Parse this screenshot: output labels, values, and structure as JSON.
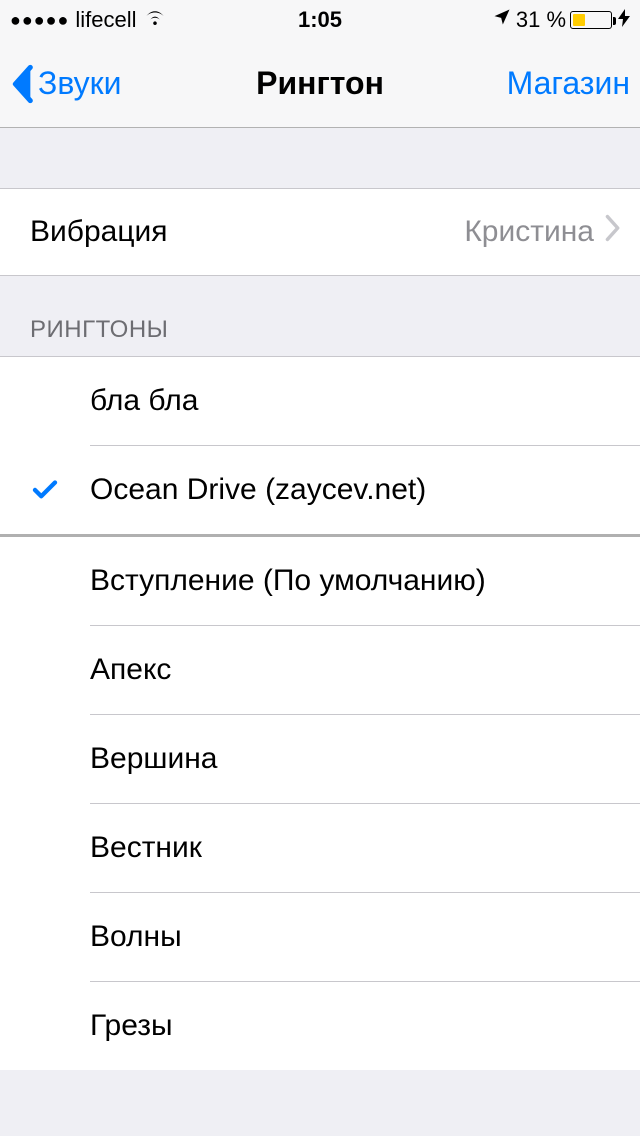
{
  "status": {
    "carrier": "lifecell",
    "time": "1:05",
    "battery_text": "31 %",
    "battery_fill_pct": 31
  },
  "nav": {
    "back_label": "Звуки",
    "title": "Рингтон",
    "right_label": "Магазин"
  },
  "vibration_row": {
    "label": "Вибрация",
    "value": "Кристина"
  },
  "ringtones_header": "РИНГТОНЫ",
  "ringtones_custom": [
    {
      "label": "бла бла",
      "selected": false
    },
    {
      "label": "Ocean Drive (zaycev.net)",
      "selected": true
    }
  ],
  "ringtones_system": [
    {
      "label": "Вступление (По умолчанию)"
    },
    {
      "label": "Апекс"
    },
    {
      "label": "Вершина"
    },
    {
      "label": "Вестник"
    },
    {
      "label": "Волны"
    },
    {
      "label": "Грезы"
    }
  ],
  "colors": {
    "tint": "#007aff",
    "battery_fill": "#ffcc00"
  }
}
